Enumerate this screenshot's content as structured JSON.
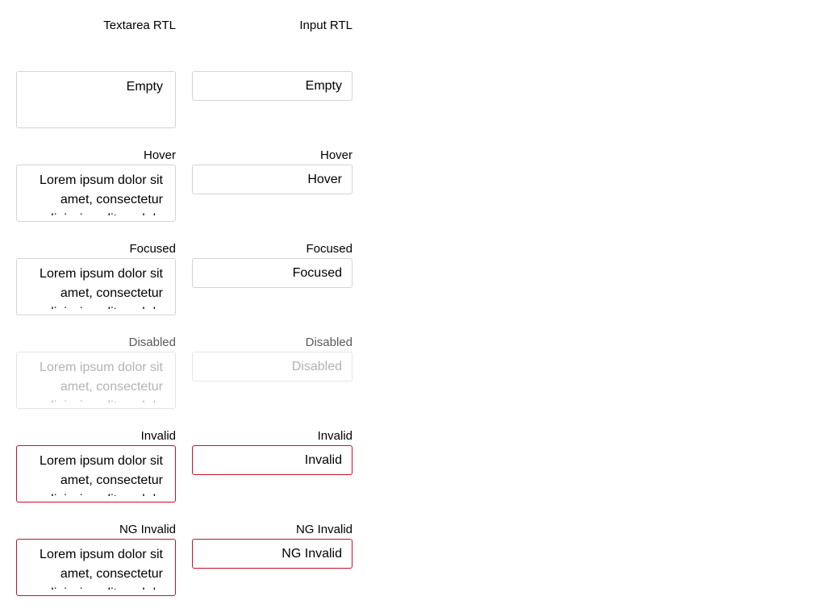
{
  "textarea_column": {
    "heading": "Textarea RTL",
    "fields": [
      {
        "label": "",
        "value": "Empty"
      },
      {
        "label": "Hover",
        "value": "Lorem ipsum dolor sit amet, consectetur adipiscing elit, sed do"
      },
      {
        "label": "Focused",
        "value": "Lorem ipsum dolor sit amet, consectetur adipiscing elit, sed do"
      },
      {
        "label": "Disabled",
        "value": "Lorem ipsum dolor sit amet, consectetur adipiscing elit, sed do"
      },
      {
        "label": "Invalid",
        "value": "Lorem ipsum dolor sit amet, consectetur adipiscing elit, sed do"
      },
      {
        "label": "NG Invalid",
        "value": "Lorem ipsum dolor sit amet, consectetur adipiscing elit, sed do"
      }
    ]
  },
  "input_column": {
    "heading": "Input RTL",
    "fields": [
      {
        "label": "",
        "value": "Empty"
      },
      {
        "label": "Hover",
        "value": "Hover"
      },
      {
        "label": "Focused",
        "value": "Focused"
      },
      {
        "label": "Disabled",
        "value": "Disabled"
      },
      {
        "label": "Invalid",
        "value": "Invalid"
      },
      {
        "label": "NG Invalid",
        "value": "NG Invalid"
      }
    ]
  },
  "colors": {
    "border": "#d4d4d4",
    "invalid_border": "#c8102e",
    "disabled_text": "#b3b3b3"
  }
}
